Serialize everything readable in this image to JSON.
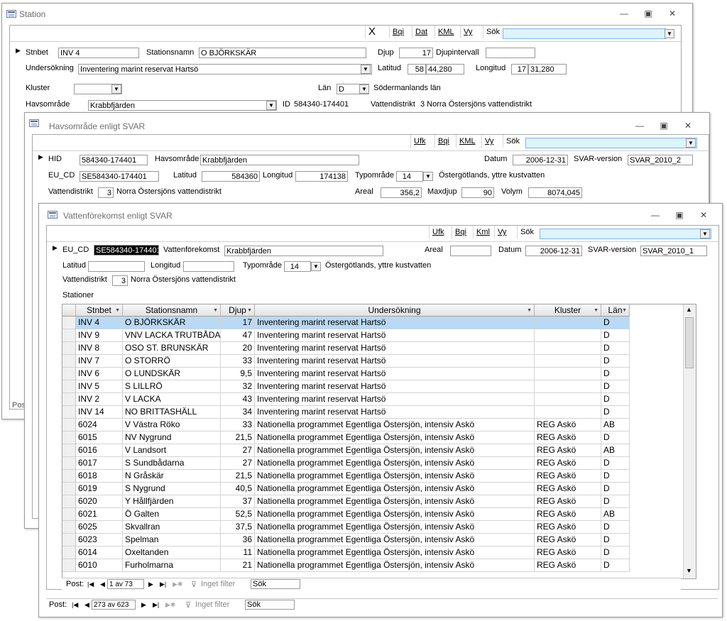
{
  "station": {
    "title": "Station",
    "toolbar": {
      "close": "X",
      "bqi": "Bqi",
      "dat": "Dat",
      "kml": "KML",
      "vy": "Vy",
      "sok": "Sök"
    },
    "fields": {
      "stnbet_label": "Stnbet",
      "stnbet": "INV 4",
      "stationsnamn_label": "Stationsnamn",
      "stationsnamn": "O BJÖRKSKÄR",
      "djup_label": "Djup",
      "djup": "17",
      "djupintervall_label": "Djupintervall",
      "djupintervall": "",
      "undersokning_label": "Undersökning",
      "undersokning": "Inventering marint reservat Hartsö",
      "latitud_label": "Latitud",
      "latitud_deg": "58",
      "latitud_min": "44,280",
      "longitud_label": "Longitud",
      "longitud_deg": "17",
      "longitud_min": "31,280",
      "kluster_label": "Kluster",
      "kluster": "",
      "lan_label": "Län",
      "lan": "D",
      "lan_name": "Södermanlands län",
      "havsomrade_label": "Havsområde",
      "havsomrade": "Krabbfjärden",
      "id_label": "ID",
      "id": "584340-174401",
      "vattendistrikt_label": "Vattendistrikt",
      "vattendistrikt": "3 Norra Östersjöns vattendistrikt"
    },
    "nav_prefix": "Post"
  },
  "havsomrade": {
    "title": "Havsområde enligt SVAR",
    "toolbar": {
      "ufk": "Ufk",
      "bqi": "Bqi",
      "kml": "KML",
      "vy": "Vy",
      "sok": "Sök"
    },
    "fields": {
      "hid_label": "HID",
      "hid": "584340-174401",
      "havsomrade_label": "Havsområde",
      "havsomrade": "Krabbfjärden",
      "datum_label": "Datum",
      "datum": "2006-12-31",
      "svar_label": "SVAR-version",
      "svar": "SVAR_2010_2",
      "eucd_label": "EU_CD",
      "eucd": "SE584340-174401",
      "latitud_label": "Latitud",
      "latitud": "584360",
      "longitud_label": "Longitud",
      "longitud": "174138",
      "typomrade_label": "Typområde",
      "typomrade": "14",
      "typomrade_name": "Östergötlands, yttre kustvatten",
      "vattendistrikt_label": "Vattendistrikt",
      "vattendistrikt_nr": "3",
      "vattendistrikt_name": "Norra Östersjöns vattendistrikt",
      "areal_label": "Areal",
      "areal": "356,2",
      "maxdjup_label": "Maxdjup",
      "maxdjup": "90",
      "volym_label": "Volym",
      "volym": "8074,045"
    },
    "nav": {
      "prefix": "Post:",
      "record": "273 av 623",
      "filter": "Inget filter",
      "search": "Sök"
    }
  },
  "vatten": {
    "title": "Vattenförekomst enligt SVAR",
    "toolbar": {
      "ufk": "Ufk",
      "bqi": "Bqi",
      "kml": "Kml",
      "vy": "Vy",
      "sok": "Sök"
    },
    "fields": {
      "eucd_label": "EU_CD",
      "eucd": "SE584340-174401",
      "vf_label": "Vattenförekomst",
      "vf": "Krabbfjärden",
      "areal_label": "Areal",
      "areal": "",
      "datum_label": "Datum",
      "datum": "2006-12-31",
      "svar_label": "SVAR-version",
      "svar": "SVAR_2010_1",
      "latitud_label": "Latitud",
      "latitud": "",
      "longitud_label": "Longitud",
      "longitud": "",
      "typomrade_label": "Typområde",
      "typomrade": "14",
      "typomrade_name": "Östergötlands, yttre kustvatten",
      "vattendistrikt_label": "Vattendistrikt",
      "vattendistrikt_nr": "3",
      "vattendistrikt_name": "Norra Östersjöns vattendistrikt",
      "stationer_label": "Stationer"
    },
    "table": {
      "columns": [
        "Stnbet",
        "Stationsnamn",
        "Djup",
        "Undersökning",
        "Kluster",
        "Län"
      ],
      "rows": [
        [
          "INV 4",
          "O BJÖRKSKÄR",
          "17",
          "Inventering marint reservat Hartsö",
          "",
          "D"
        ],
        [
          "INV 9",
          "VNV LACKA TRUTBÅDAN",
          "47",
          "Inventering marint reservat Hartsö",
          "",
          "D"
        ],
        [
          "INV 8",
          "OSO ST. BRUNSKÄR",
          "20",
          "Inventering marint reservat Hartsö",
          "",
          "D"
        ],
        [
          "INV 7",
          "O STORRÖ",
          "33",
          "Inventering marint reservat Hartsö",
          "",
          "D"
        ],
        [
          "INV 6",
          "O LUNDSKÄR",
          "9,5",
          "Inventering marint reservat Hartsö",
          "",
          "D"
        ],
        [
          "INV 5",
          "S LILLRÖ",
          "32",
          "Inventering marint reservat Hartsö",
          "",
          "D"
        ],
        [
          "INV 2",
          "V LACKA",
          "43",
          "Inventering marint reservat Hartsö",
          "",
          "D"
        ],
        [
          "INV 14",
          "NO BRITTASHÄLL",
          "34",
          "Inventering marint reservat Hartsö",
          "",
          "D"
        ],
        [
          "6024",
          "V Västra Röko",
          "33",
          "Nationella programmet Egentliga Östersjön, intensiv Askö",
          "REG Askö",
          "AB"
        ],
        [
          "6015",
          "NV Nygrund",
          "21,5",
          "Nationella programmet Egentliga Östersjön, intensiv Askö",
          "REG Askö",
          "D"
        ],
        [
          "6016",
          "V Landsort",
          "27",
          "Nationella programmet Egentliga Östersjön, intensiv Askö",
          "REG Askö",
          "AB"
        ],
        [
          "6017",
          "S Sundbådarna",
          "27",
          "Nationella programmet Egentliga Östersjön, intensiv Askö",
          "REG Askö",
          "D"
        ],
        [
          "6018",
          "N Gråskär",
          "21,5",
          "Nationella programmet Egentliga Östersjön, intensiv Askö",
          "REG Askö",
          "D"
        ],
        [
          "6019",
          "S Nygrund",
          "40,5",
          "Nationella programmet Egentliga Östersjön, intensiv Askö",
          "REG Askö",
          "D"
        ],
        [
          "6020",
          "Y Hållfjärden",
          "37",
          "Nationella programmet Egentliga Östersjön, intensiv Askö",
          "REG Askö",
          "D"
        ],
        [
          "6021",
          "Ö Galten",
          "52,5",
          "Nationella programmet Egentliga Östersjön, intensiv Askö",
          "REG Askö",
          "AB"
        ],
        [
          "6025",
          "Skvallran",
          "37,5",
          "Nationella programmet Egentliga Östersjön, intensiv Askö",
          "REG Askö",
          "D"
        ],
        [
          "6023",
          "Spelman",
          "36",
          "Nationella programmet Egentliga Östersjön, intensiv Askö",
          "REG Askö",
          "D"
        ],
        [
          "6014",
          "Oxeltanden",
          "11",
          "Nationella programmet Egentliga Östersjön, intensiv Askö",
          "REG Askö",
          "D"
        ],
        [
          "6010",
          "Furholmarna",
          "21",
          "Nationella programmet Egentliga Östersjön, intensiv Askö",
          "REG Askö",
          "D"
        ]
      ]
    },
    "nav": {
      "prefix": "Post:",
      "record": "1 av 73",
      "filter": "Inget filter",
      "search": "Sök"
    }
  }
}
